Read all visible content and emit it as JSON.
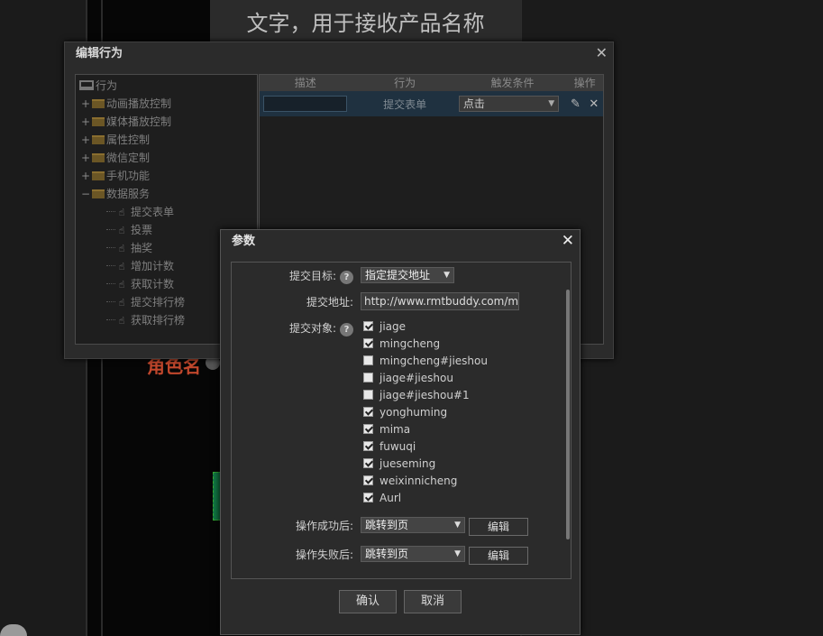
{
  "canvas": {
    "product_text": "文字，用于接收产品名称",
    "role_text": "角色名"
  },
  "behavior_window": {
    "title": "编辑行为",
    "close": "✕",
    "tree": {
      "root": "行为",
      "folders": [
        {
          "expander": "+",
          "label": "动画播放控制"
        },
        {
          "expander": "+",
          "label": "媒体播放控制"
        },
        {
          "expander": "+",
          "label": "属性控制"
        },
        {
          "expander": "+",
          "label": "微信定制"
        },
        {
          "expander": "+",
          "label": "手机功能"
        },
        {
          "expander": "−",
          "label": "数据服务"
        }
      ],
      "children": [
        "提交表单",
        "投票",
        "抽奖",
        "增加计数",
        "获取计数",
        "提交排行榜",
        "获取排行榜"
      ]
    },
    "table": {
      "headers": [
        "描述",
        "行为",
        "触发条件",
        "操作"
      ],
      "rows": [
        {
          "desc": "",
          "action": "提交表单",
          "trigger": "点击"
        }
      ]
    }
  },
  "params_dialog": {
    "title": "参数",
    "close": "✕",
    "submit_target_label": "提交目标:",
    "submit_target_value": "指定提交地址",
    "submit_url_label": "提交地址:",
    "submit_url_value": "http://www.rmtbuddy.com/mu",
    "submit_objects_label": "提交对象:",
    "help": "?",
    "objects": [
      {
        "name": "jiage",
        "checked": true
      },
      {
        "name": "mingcheng",
        "checked": true
      },
      {
        "name": "mingcheng#jieshou",
        "checked": false
      },
      {
        "name": "jiage#jieshou",
        "checked": false
      },
      {
        "name": "jiage#jieshou#1",
        "checked": false
      },
      {
        "name": "yonghuming",
        "checked": true
      },
      {
        "name": "mima",
        "checked": true
      },
      {
        "name": "fuwuqi",
        "checked": true
      },
      {
        "name": "jueseming",
        "checked": true
      },
      {
        "name": "weixinnicheng",
        "checked": true
      },
      {
        "name": "Aurl",
        "checked": true
      }
    ],
    "on_success_label": "操作成功后:",
    "on_success_value": "跳转到页",
    "on_fail_label": "操作失败后:",
    "on_fail_value": "跳转到页",
    "edit_label": "编辑",
    "confirm_label": "确认",
    "cancel_label": "取消",
    "arrow": "▼"
  }
}
